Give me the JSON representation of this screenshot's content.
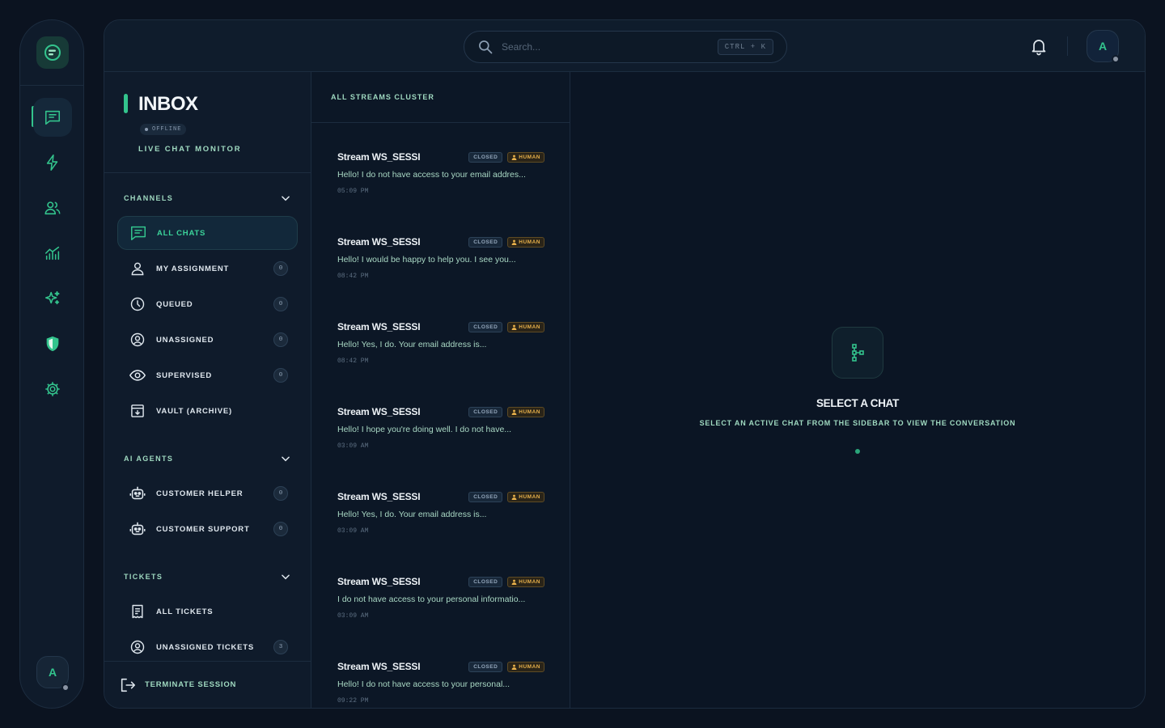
{
  "rail": {
    "avatar_letter": "A",
    "icons": [
      "chat-icon",
      "lightning-icon",
      "users-icon",
      "analytics-icon",
      "sparkles-icon",
      "shield-icon",
      "settings-gear-icon"
    ]
  },
  "topbar": {
    "search_placeholder": "Search...",
    "shortcut": "CTRL + K",
    "avatar_letter": "A"
  },
  "sidebar": {
    "title": "INBOX",
    "status": "OFFLINE",
    "subtitle": "LIVE CHAT MONITOR",
    "channels": {
      "heading": "CHANNELS",
      "items": [
        {
          "label": "ALL CHATS",
          "count": ""
        },
        {
          "label": "MY ASSIGNMENT",
          "count": "0"
        },
        {
          "label": "QUEUED",
          "count": "0"
        },
        {
          "label": "UNASSIGNED",
          "count": "0"
        },
        {
          "label": "SUPERVISED",
          "count": "0"
        },
        {
          "label": "VAULT (ARCHIVE)",
          "count": ""
        }
      ]
    },
    "ai_agents": {
      "heading": "AI AGENTS",
      "items": [
        {
          "label": "CUSTOMER HELPER",
          "count": "0"
        },
        {
          "label": "CUSTOMER SUPPORT",
          "count": "0"
        }
      ]
    },
    "tickets": {
      "heading": "TICKETS",
      "items": [
        {
          "label": "ALL TICKETS",
          "count": ""
        },
        {
          "label": "UNASSIGNED TICKETS",
          "count": "3"
        }
      ]
    },
    "footer_label": "TERMINATE SESSION"
  },
  "list": {
    "heading": "ALL STREAMS CLUSTER",
    "chats": [
      {
        "name": "Stream WS_SESSI",
        "status": "CLOSED",
        "type": "HUMAN",
        "message": "Hello! I do not have access to your email addres...",
        "time": "05:09 PM"
      },
      {
        "name": "Stream WS_SESSI",
        "status": "CLOSED",
        "type": "HUMAN",
        "message": "Hello! I would be happy to help you. I see you...",
        "time": "08:42 PM"
      },
      {
        "name": "Stream WS_SESSI",
        "status": "CLOSED",
        "type": "HUMAN",
        "message": "Hello! Yes, I do. Your email address is...",
        "time": "08:42 PM"
      },
      {
        "name": "Stream WS_SESSI",
        "status": "CLOSED",
        "type": "HUMAN",
        "message": "Hello! I hope you're doing well. I do not have...",
        "time": "03:09 AM"
      },
      {
        "name": "Stream WS_SESSI",
        "status": "CLOSED",
        "type": "HUMAN",
        "message": "Hello! Yes, I do. Your email address is...",
        "time": "03:09 AM"
      },
      {
        "name": "Stream WS_SESSI",
        "status": "CLOSED",
        "type": "HUMAN",
        "message": "I do not have access to your personal informatio...",
        "time": "03:09 AM"
      },
      {
        "name": "Stream WS_SESSI",
        "status": "CLOSED",
        "type": "HUMAN",
        "message": "Hello! I do not have access to your personal...",
        "time": "09:22 PM"
      }
    ]
  },
  "empty_state": {
    "title": "SELECT A CHAT",
    "subtitle": "SELECT AN ACTIVE CHAT FROM THE SIDEBAR TO VIEW THE CONVERSATION"
  },
  "colors": {
    "accent": "#33c48d",
    "background": "#0b1320",
    "panel": "#0f1b2b",
    "human_badge": "#e7b04a"
  }
}
